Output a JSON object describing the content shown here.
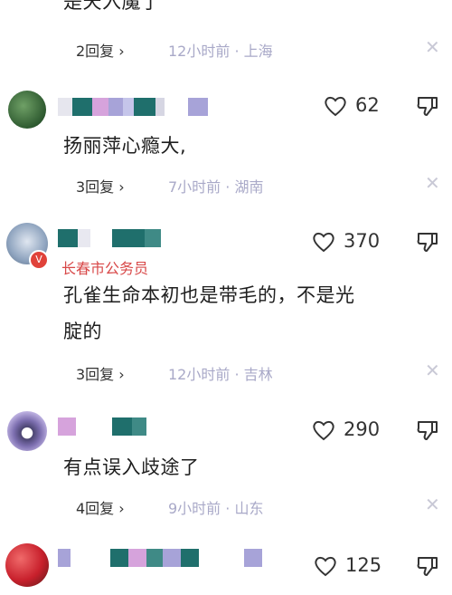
{
  "comments": [
    {
      "body": "是天入魔了",
      "replies": "2回复",
      "meta": "12小时前 · 上海"
    },
    {
      "likes": "62",
      "body": "扬丽萍心瘾大,",
      "replies": "3回复",
      "meta": "7小时前 · 湖南"
    },
    {
      "likes": "370",
      "role": "长春市公务员",
      "body_line1": "孔雀生命本初也是带毛的，不是光",
      "body_line2": "腚的",
      "replies": "3回复",
      "meta": "12小时前 · 吉林"
    },
    {
      "likes": "290",
      "body": "有点误入歧途了",
      "replies": "4回复",
      "meta": "9小时前 · 山东"
    },
    {
      "likes": "125"
    }
  ],
  "colors": {
    "meta": "#a9a9c8",
    "role": "#d84848",
    "teal_block": "#1f6f6c",
    "pink_block": "#d6a3dc",
    "lavender_block": "#a7a3d8"
  },
  "icons": [
    "heart-icon",
    "thumb-down-icon",
    "close-icon",
    "chevron-right-icon",
    "verified-badge-icon"
  ]
}
